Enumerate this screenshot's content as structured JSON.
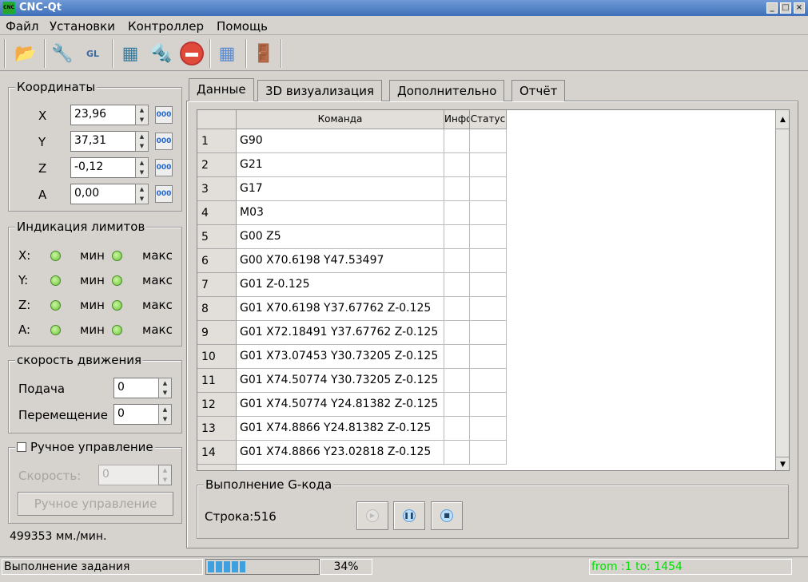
{
  "window": {
    "title": "CNC-Qt",
    "logo": "CNC",
    "buttons": [
      "minimize",
      "maximize",
      "close"
    ]
  },
  "menu": [
    "Файл",
    "Установки",
    "Контроллер",
    "Помощь"
  ],
  "toolbar": [
    {
      "icon": "open-folder-icon"
    },
    {
      "icon": "settings-icon"
    },
    {
      "icon": "opengl-icon"
    },
    {
      "icon": "controller-board-icon"
    },
    {
      "icon": "drill-icon"
    },
    {
      "icon": "stop-icon"
    },
    {
      "icon": "grid-icon"
    },
    {
      "icon": "exit-door-icon"
    }
  ],
  "coords": {
    "title": "Координаты",
    "axes": [
      {
        "label": "X",
        "value": "23,96"
      },
      {
        "label": "Y",
        "value": "37,31"
      },
      {
        "label": "Z",
        "value": "-0,12"
      },
      {
        "label": "A",
        "value": "0,00"
      }
    ],
    "zero_label": "000"
  },
  "limits": {
    "title": "Индикация лимитов",
    "min": "мин",
    "max": "макс",
    "axes": [
      "X:",
      "Y:",
      "Z:",
      "A:"
    ],
    "led_color": "#6cc43a"
  },
  "speed": {
    "title": "скорость движения",
    "feed_label": "Подача",
    "feed_value": "0",
    "move_label": "Перемещение",
    "move_value": "0"
  },
  "manual": {
    "title": "Ручное управление",
    "checked": false,
    "speed_label": "Скорость:",
    "speed_value": "0",
    "button": "Ручное управление"
  },
  "velocity_text": "499353 мм./мин.",
  "tabs": [
    "Данные",
    "3D визуализация",
    "Дополнительно",
    "Отчёт"
  ],
  "table": {
    "headers": [
      "Команда",
      "Инфо",
      "Статус"
    ],
    "rows": [
      [
        "1",
        "G90"
      ],
      [
        "2",
        "G21"
      ],
      [
        "3",
        "G17"
      ],
      [
        "4",
        "M03"
      ],
      [
        "5",
        "G00 Z5"
      ],
      [
        "6",
        "G00 X70.6198 Y47.53497"
      ],
      [
        "7",
        "G01 Z-0.125"
      ],
      [
        "8",
        "G01 X70.6198 Y37.67762 Z-0.125"
      ],
      [
        "9",
        "G01 X72.18491 Y37.67762 Z-0.125"
      ],
      [
        "10",
        "G01 X73.07453 Y30.73205 Z-0.125"
      ],
      [
        "11",
        "G01 X74.50774 Y30.73205 Z-0.125"
      ],
      [
        "12",
        "G01 X74.50774 Y24.81382 Z-0.125"
      ],
      [
        "13",
        "G01 X74.8866 Y24.81382 Z-0.125"
      ],
      [
        "14",
        "G01 X74.8866 Y23.02818 Z-0.125"
      ]
    ]
  },
  "gcode": {
    "title": "Выполнение G-кода",
    "line_text": "Строка:516",
    "buttons": [
      "play",
      "pause",
      "stop"
    ]
  },
  "status": {
    "task": "Выполнение задания",
    "progress_percent": 34,
    "progress_text": "34%",
    "range": "from :1 to: 1454",
    "range_color": "#00e000",
    "accent": "#3fa0e0"
  }
}
